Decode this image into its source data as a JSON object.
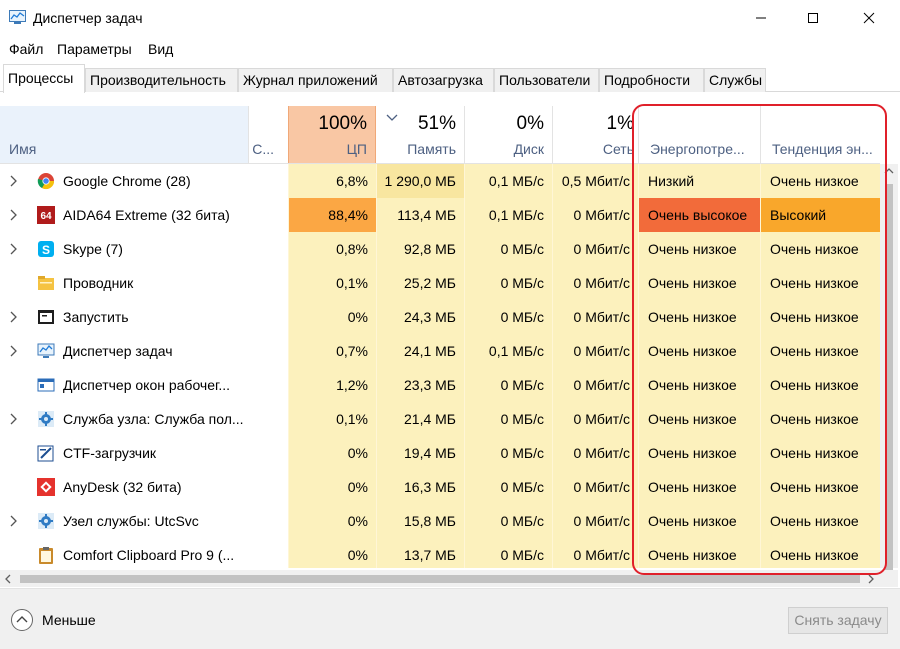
{
  "window": {
    "title": "Диспетчер задач"
  },
  "menu": [
    "Файл",
    "Параметры",
    "Вид"
  ],
  "tabs": [
    "Процессы",
    "Производительность",
    "Журнал приложений",
    "Автозагрузка",
    "Пользователи",
    "Подробности",
    "Службы"
  ],
  "active_tab": 0,
  "columns": {
    "name": "Имя",
    "status": "С...",
    "cpu": {
      "pct": "100%",
      "label": "ЦП"
    },
    "memory": {
      "pct": "51%",
      "label": "Память"
    },
    "disk": {
      "pct": "0%",
      "label": "Диск"
    },
    "network": {
      "pct": "1%",
      "label": "Сеть"
    },
    "power": "Энергопотре...",
    "power_trend": "Тенденция эн..."
  },
  "colors": {
    "cpu_header": "#f9c7a4",
    "low_usage": "#fcf1bd",
    "medium_usage": "#f8e6a0",
    "high_usage": "#fba744",
    "very_high_power": "#f26b3a",
    "high_trend": "#f9a72b",
    "highlight_frame": "#e0202a"
  },
  "processes": [
    {
      "icon": "chrome-icon",
      "expand": true,
      "name": "Google Chrome (28)",
      "cpu": "6,8%",
      "mem": "1 290,0 МБ",
      "disk": "0,1 МБ/с",
      "net": "0,5 Мбит/с",
      "power": "Низкий",
      "trend": "Очень низкое"
    },
    {
      "icon": "aida64-icon",
      "expand": true,
      "name": "AIDA64 Extreme (32 бита)",
      "cpu": "88,4%",
      "mem": "113,4 МБ",
      "disk": "0,1 МБ/с",
      "net": "0 Мбит/с",
      "power": "Очень высокое",
      "trend": "Высокий"
    },
    {
      "icon": "skype-icon",
      "expand": true,
      "name": "Skype (7)",
      "cpu": "0,8%",
      "mem": "92,8 МБ",
      "disk": "0 МБ/с",
      "net": "0 Мбит/с",
      "power": "Очень низкое",
      "trend": "Очень низкое"
    },
    {
      "icon": "explorer-icon",
      "expand": false,
      "name": "Проводник",
      "cpu": "0,1%",
      "mem": "25,2 МБ",
      "disk": "0 МБ/с",
      "net": "0 Мбит/с",
      "power": "Очень низкое",
      "trend": "Очень низкое"
    },
    {
      "icon": "run-icon",
      "expand": true,
      "name": "Запустить",
      "cpu": "0%",
      "mem": "24,3 МБ",
      "disk": "0 МБ/с",
      "net": "0 Мбит/с",
      "power": "Очень низкое",
      "trend": "Очень низкое"
    },
    {
      "icon": "taskmgr-icon",
      "expand": true,
      "name": "Диспетчер задач",
      "cpu": "0,7%",
      "mem": "24,1 МБ",
      "disk": "0,1 МБ/с",
      "net": "0 Мбит/с",
      "power": "Очень низкое",
      "trend": "Очень низкое"
    },
    {
      "icon": "dwm-icon",
      "expand": false,
      "name": "Диспетчер окон рабочег...",
      "cpu": "1,2%",
      "mem": "23,3 МБ",
      "disk": "0 МБ/с",
      "net": "0 Мбит/с",
      "power": "Очень низкое",
      "trend": "Очень низкое"
    },
    {
      "icon": "service-host-icon",
      "expand": true,
      "name": "Служба узла: Служба пол...",
      "cpu": "0,1%",
      "mem": "21,4 МБ",
      "disk": "0 МБ/с",
      "net": "0 Мбит/с",
      "power": "Очень низкое",
      "trend": "Очень низкое"
    },
    {
      "icon": "ctf-icon",
      "expand": false,
      "name": "CTF-загрузчик",
      "cpu": "0%",
      "mem": "19,4 МБ",
      "disk": "0 МБ/с",
      "net": "0 Мбит/с",
      "power": "Очень низкое",
      "trend": "Очень низкое"
    },
    {
      "icon": "anydesk-icon",
      "expand": false,
      "name": "AnyDesk (32 бита)",
      "cpu": "0%",
      "mem": "16,3 МБ",
      "disk": "0 МБ/с",
      "net": "0 Мбит/с",
      "power": "Очень низкое",
      "trend": "Очень низкое"
    },
    {
      "icon": "service-host-icon",
      "expand": true,
      "name": "Узел службы: UtcSvc",
      "cpu": "0%",
      "mem": "15,8 МБ",
      "disk": "0 МБ/с",
      "net": "0 Мбит/с",
      "power": "Очень низкое",
      "trend": "Очень низкое"
    },
    {
      "icon": "clipboard-icon",
      "expand": false,
      "name": "Comfort Clipboard Pro 9 (...",
      "cpu": "0%",
      "mem": "13,7 МБ",
      "disk": "0 МБ/с",
      "net": "0 Мбит/с",
      "power": "Очень низкое",
      "trend": "Очень низкое"
    }
  ],
  "footer": {
    "less": "Меньше",
    "end_task": "Снять задачу"
  }
}
